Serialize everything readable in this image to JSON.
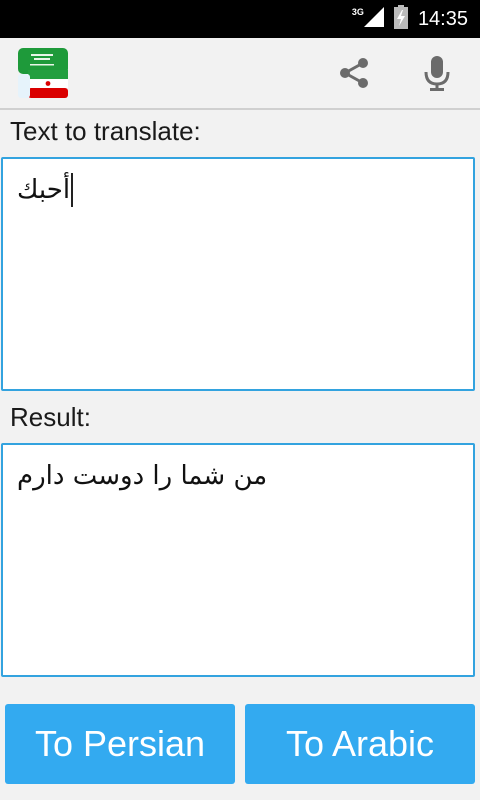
{
  "status_bar": {
    "network": "3G",
    "time": "14:35"
  },
  "action_bar": {
    "app_icon": "saudi-iran-flags-logo",
    "actions": [
      "share-icon",
      "microphone-icon"
    ]
  },
  "source": {
    "label": "Text to translate:",
    "value": "أحبك"
  },
  "result": {
    "label": "Result:",
    "value": "من شما را دوست دارم"
  },
  "buttons": {
    "to_persian": "To Persian",
    "to_arabic": "To Arabic"
  },
  "colors": {
    "accent": "#33a3df",
    "button": "#33aaf0",
    "statusbar": "#000000"
  }
}
